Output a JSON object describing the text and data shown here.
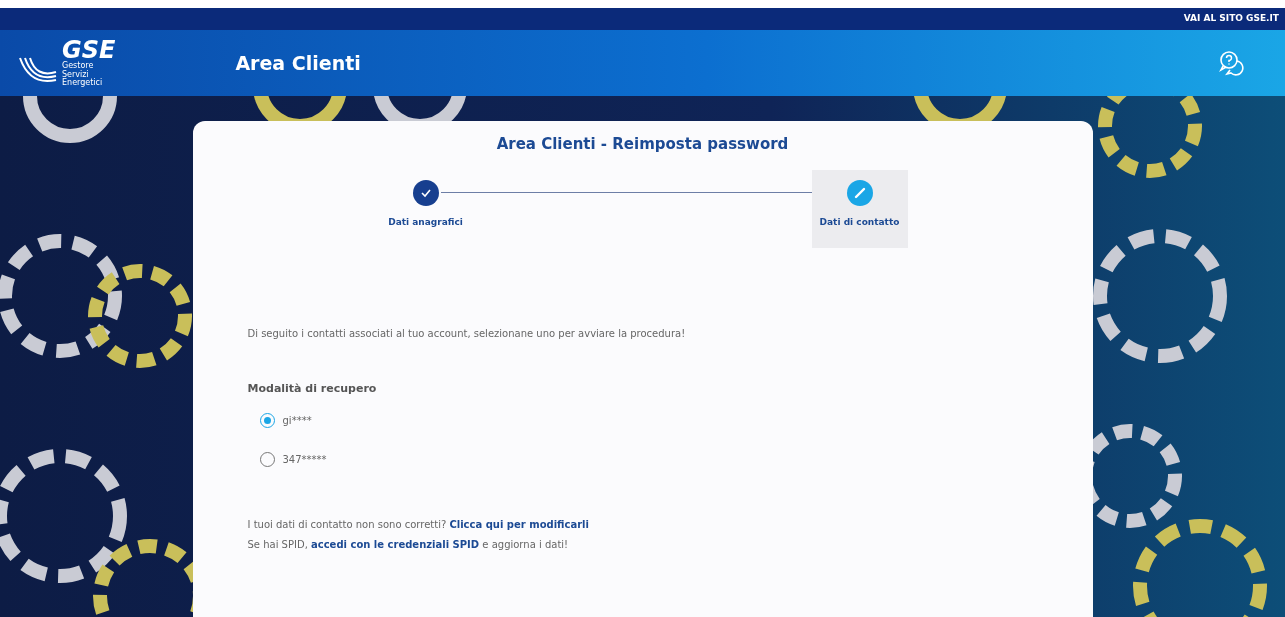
{
  "top_bar": {
    "link": "VAI AL SITO GSE.IT"
  },
  "header": {
    "logo_text": "GSE",
    "logo_subtitle": [
      "Gestore",
      "Servizi",
      "Energetici"
    ],
    "title": "Area Clienti"
  },
  "card": {
    "title": "Area Clienti - Reimposta password",
    "steps": [
      {
        "label": "Dati anagrafici",
        "completed": true,
        "selected": false
      },
      {
        "label": "Dati di contatto",
        "completed": false,
        "selected": true
      }
    ],
    "intro": "Di seguito i contatti associati al tuo account, selezionane uno per avviare la procedura!",
    "recovery_label": "Modalità di recupero",
    "options": [
      {
        "label": "gi****",
        "selected": true
      },
      {
        "label": "347*****",
        "selected": false
      }
    ],
    "help_lines": [
      {
        "parts": [
          {
            "kind": "text",
            "text": "I tuoi dati di contatto non sono corretti? "
          },
          {
            "kind": "link",
            "text": "Clicca qui per modificarli"
          }
        ]
      },
      {
        "parts": [
          {
            "kind": "text",
            "text": "Se hai SPID, "
          },
          {
            "kind": "link",
            "text": "accedi con le credenziali SPID"
          },
          {
            "kind": "text",
            "text": " e aggiorna i dati!"
          }
        ]
      }
    ]
  }
}
